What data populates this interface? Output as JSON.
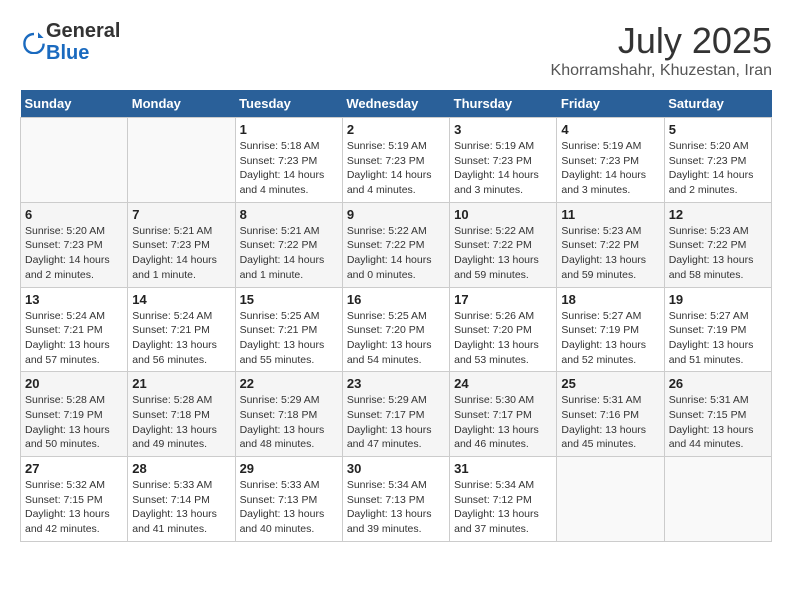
{
  "header": {
    "logo": {
      "line1": "General",
      "line2": "Blue"
    },
    "title": "July 2025",
    "subtitle": "Khorramshahr, Khuzestan, Iran"
  },
  "days_of_week": [
    "Sunday",
    "Monday",
    "Tuesday",
    "Wednesday",
    "Thursday",
    "Friday",
    "Saturday"
  ],
  "weeks": [
    [
      {
        "day": "",
        "info": ""
      },
      {
        "day": "",
        "info": ""
      },
      {
        "day": "1",
        "info": "Sunrise: 5:18 AM\nSunset: 7:23 PM\nDaylight: 14 hours\nand 4 minutes."
      },
      {
        "day": "2",
        "info": "Sunrise: 5:19 AM\nSunset: 7:23 PM\nDaylight: 14 hours\nand 4 minutes."
      },
      {
        "day": "3",
        "info": "Sunrise: 5:19 AM\nSunset: 7:23 PM\nDaylight: 14 hours\nand 3 minutes."
      },
      {
        "day": "4",
        "info": "Sunrise: 5:19 AM\nSunset: 7:23 PM\nDaylight: 14 hours\nand 3 minutes."
      },
      {
        "day": "5",
        "info": "Sunrise: 5:20 AM\nSunset: 7:23 PM\nDaylight: 14 hours\nand 2 minutes."
      }
    ],
    [
      {
        "day": "6",
        "info": "Sunrise: 5:20 AM\nSunset: 7:23 PM\nDaylight: 14 hours\nand 2 minutes."
      },
      {
        "day": "7",
        "info": "Sunrise: 5:21 AM\nSunset: 7:23 PM\nDaylight: 14 hours\nand 1 minute."
      },
      {
        "day": "8",
        "info": "Sunrise: 5:21 AM\nSunset: 7:22 PM\nDaylight: 14 hours\nand 1 minute."
      },
      {
        "day": "9",
        "info": "Sunrise: 5:22 AM\nSunset: 7:22 PM\nDaylight: 14 hours\nand 0 minutes."
      },
      {
        "day": "10",
        "info": "Sunrise: 5:22 AM\nSunset: 7:22 PM\nDaylight: 13 hours\nand 59 minutes."
      },
      {
        "day": "11",
        "info": "Sunrise: 5:23 AM\nSunset: 7:22 PM\nDaylight: 13 hours\nand 59 minutes."
      },
      {
        "day": "12",
        "info": "Sunrise: 5:23 AM\nSunset: 7:22 PM\nDaylight: 13 hours\nand 58 minutes."
      }
    ],
    [
      {
        "day": "13",
        "info": "Sunrise: 5:24 AM\nSunset: 7:21 PM\nDaylight: 13 hours\nand 57 minutes."
      },
      {
        "day": "14",
        "info": "Sunrise: 5:24 AM\nSunset: 7:21 PM\nDaylight: 13 hours\nand 56 minutes."
      },
      {
        "day": "15",
        "info": "Sunrise: 5:25 AM\nSunset: 7:21 PM\nDaylight: 13 hours\nand 55 minutes."
      },
      {
        "day": "16",
        "info": "Sunrise: 5:25 AM\nSunset: 7:20 PM\nDaylight: 13 hours\nand 54 minutes."
      },
      {
        "day": "17",
        "info": "Sunrise: 5:26 AM\nSunset: 7:20 PM\nDaylight: 13 hours\nand 53 minutes."
      },
      {
        "day": "18",
        "info": "Sunrise: 5:27 AM\nSunset: 7:19 PM\nDaylight: 13 hours\nand 52 minutes."
      },
      {
        "day": "19",
        "info": "Sunrise: 5:27 AM\nSunset: 7:19 PM\nDaylight: 13 hours\nand 51 minutes."
      }
    ],
    [
      {
        "day": "20",
        "info": "Sunrise: 5:28 AM\nSunset: 7:19 PM\nDaylight: 13 hours\nand 50 minutes."
      },
      {
        "day": "21",
        "info": "Sunrise: 5:28 AM\nSunset: 7:18 PM\nDaylight: 13 hours\nand 49 minutes."
      },
      {
        "day": "22",
        "info": "Sunrise: 5:29 AM\nSunset: 7:18 PM\nDaylight: 13 hours\nand 48 minutes."
      },
      {
        "day": "23",
        "info": "Sunrise: 5:29 AM\nSunset: 7:17 PM\nDaylight: 13 hours\nand 47 minutes."
      },
      {
        "day": "24",
        "info": "Sunrise: 5:30 AM\nSunset: 7:17 PM\nDaylight: 13 hours\nand 46 minutes."
      },
      {
        "day": "25",
        "info": "Sunrise: 5:31 AM\nSunset: 7:16 PM\nDaylight: 13 hours\nand 45 minutes."
      },
      {
        "day": "26",
        "info": "Sunrise: 5:31 AM\nSunset: 7:15 PM\nDaylight: 13 hours\nand 44 minutes."
      }
    ],
    [
      {
        "day": "27",
        "info": "Sunrise: 5:32 AM\nSunset: 7:15 PM\nDaylight: 13 hours\nand 42 minutes."
      },
      {
        "day": "28",
        "info": "Sunrise: 5:33 AM\nSunset: 7:14 PM\nDaylight: 13 hours\nand 41 minutes."
      },
      {
        "day": "29",
        "info": "Sunrise: 5:33 AM\nSunset: 7:13 PM\nDaylight: 13 hours\nand 40 minutes."
      },
      {
        "day": "30",
        "info": "Sunrise: 5:34 AM\nSunset: 7:13 PM\nDaylight: 13 hours\nand 39 minutes."
      },
      {
        "day": "31",
        "info": "Sunrise: 5:34 AM\nSunset: 7:12 PM\nDaylight: 13 hours\nand 37 minutes."
      },
      {
        "day": "",
        "info": ""
      },
      {
        "day": "",
        "info": ""
      }
    ]
  ]
}
